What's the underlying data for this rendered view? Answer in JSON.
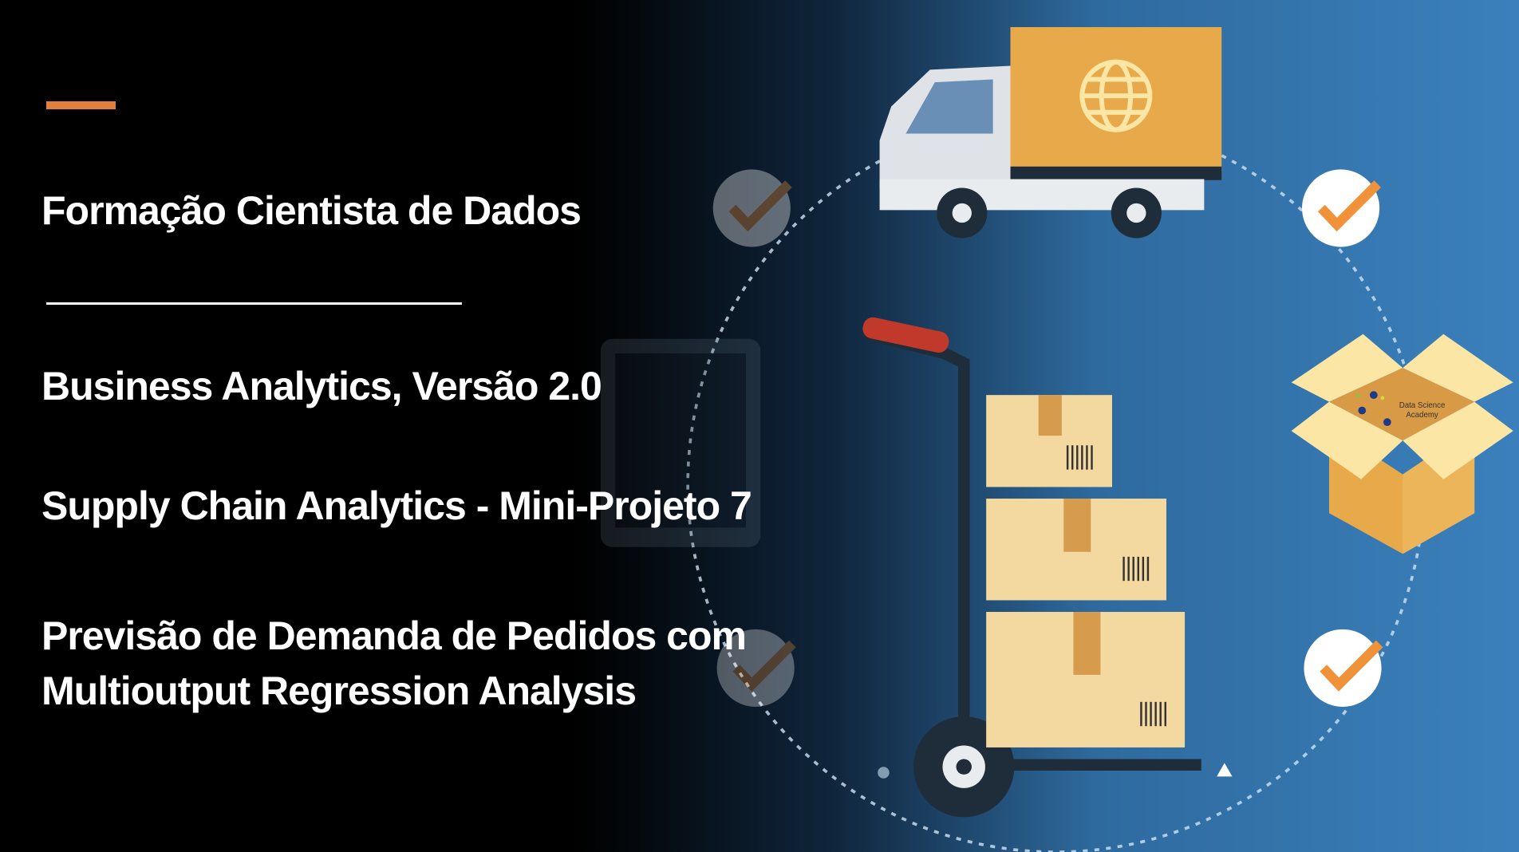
{
  "slide": {
    "program": "Formação Cientista de Dados",
    "course": "Business Analytics, Versão 2.0",
    "module": "Supply Chain Analytics - Mini-Projeto 7",
    "title_line1": "Previsão de Demanda de Pedidos com",
    "title_line2": "Multioutput Regression Analysis"
  },
  "logo": {
    "text_line1": "Data Science",
    "text_line2": "Academy"
  },
  "colors": {
    "accent": "#e0803a",
    "blue": "#3a7db8",
    "box": "#e8a94a",
    "box_light": "#fbe6a6",
    "check": "#f0923a"
  }
}
